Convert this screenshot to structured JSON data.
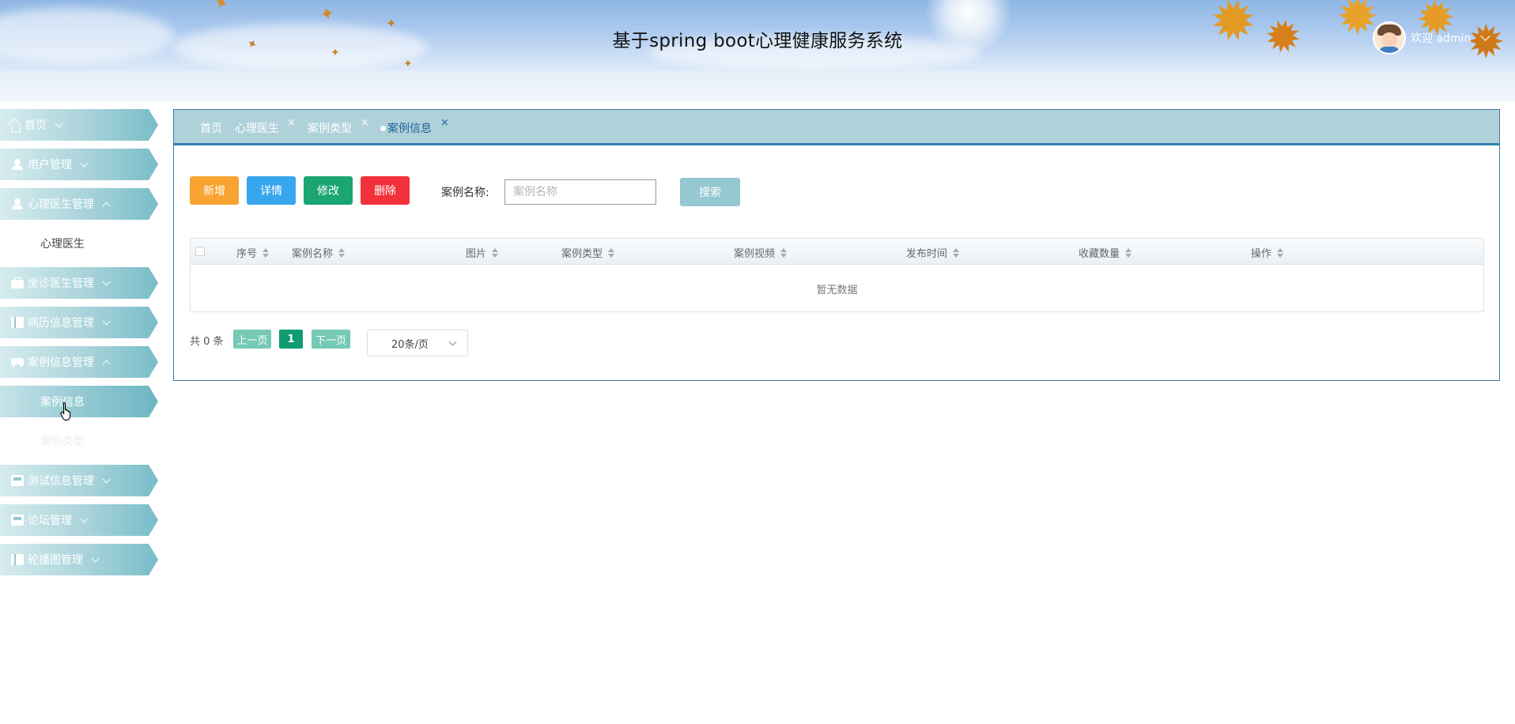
{
  "header": {
    "title": "基于spring boot心理健康服务系统",
    "welcome": "欢迎 admin"
  },
  "sidebar": {
    "items": [
      {
        "label": "首页",
        "icon": "home-icon",
        "expanded": false
      },
      {
        "label": "用户管理",
        "icon": "user-icon",
        "expanded": false
      },
      {
        "label": "心理医生管理",
        "icon": "user-icon",
        "expanded": true,
        "children": [
          "心理医生"
        ]
      },
      {
        "label": "坐诊医生管理",
        "icon": "briefcase-icon",
        "expanded": false
      },
      {
        "label": "病历信息管理",
        "icon": "book-icon",
        "expanded": false
      },
      {
        "label": "案例信息管理",
        "icon": "car-icon",
        "expanded": true,
        "children": [
          "案例信息",
          "案例类型"
        ]
      },
      {
        "label": "测试信息管理",
        "icon": "store-icon",
        "expanded": false
      },
      {
        "label": "论坛管理",
        "icon": "store-icon",
        "expanded": false
      },
      {
        "label": "轮播图管理",
        "icon": "book-icon",
        "expanded": false
      }
    ]
  },
  "tabs": [
    {
      "label": "首页",
      "closable": false,
      "active": false
    },
    {
      "label": "心理医生",
      "closable": true,
      "active": false
    },
    {
      "label": "案例类型",
      "closable": true,
      "active": false
    },
    {
      "label": "案例信息",
      "closable": true,
      "active": true
    }
  ],
  "tab_close_glyph": "×",
  "toolbar": {
    "add": "新增",
    "detail": "详情",
    "edit": "修改",
    "delete": "删除",
    "search_label": "案例名称:",
    "search_placeholder": "案例名称",
    "search_value": "",
    "search_button": "搜索"
  },
  "table": {
    "columns": [
      "序号",
      "案例名称",
      "图片",
      "案例类型",
      "案例视频",
      "发布时间",
      "收藏数量",
      "操作"
    ],
    "rows": [],
    "empty_text": "暂无数据"
  },
  "pagination": {
    "total_text": "共 0 条",
    "prev": "上一页",
    "current_page": "1",
    "next": "下一页",
    "page_size": "20条/页"
  },
  "colors": {
    "add": "#f9a430",
    "detail": "#38a6ee",
    "edit": "#1aa573",
    "delete": "#f2313b",
    "search": "#95c8d0",
    "tabbar": "#afd2da",
    "panel_border": "#3e7aa8",
    "page_active": "#109c72"
  }
}
